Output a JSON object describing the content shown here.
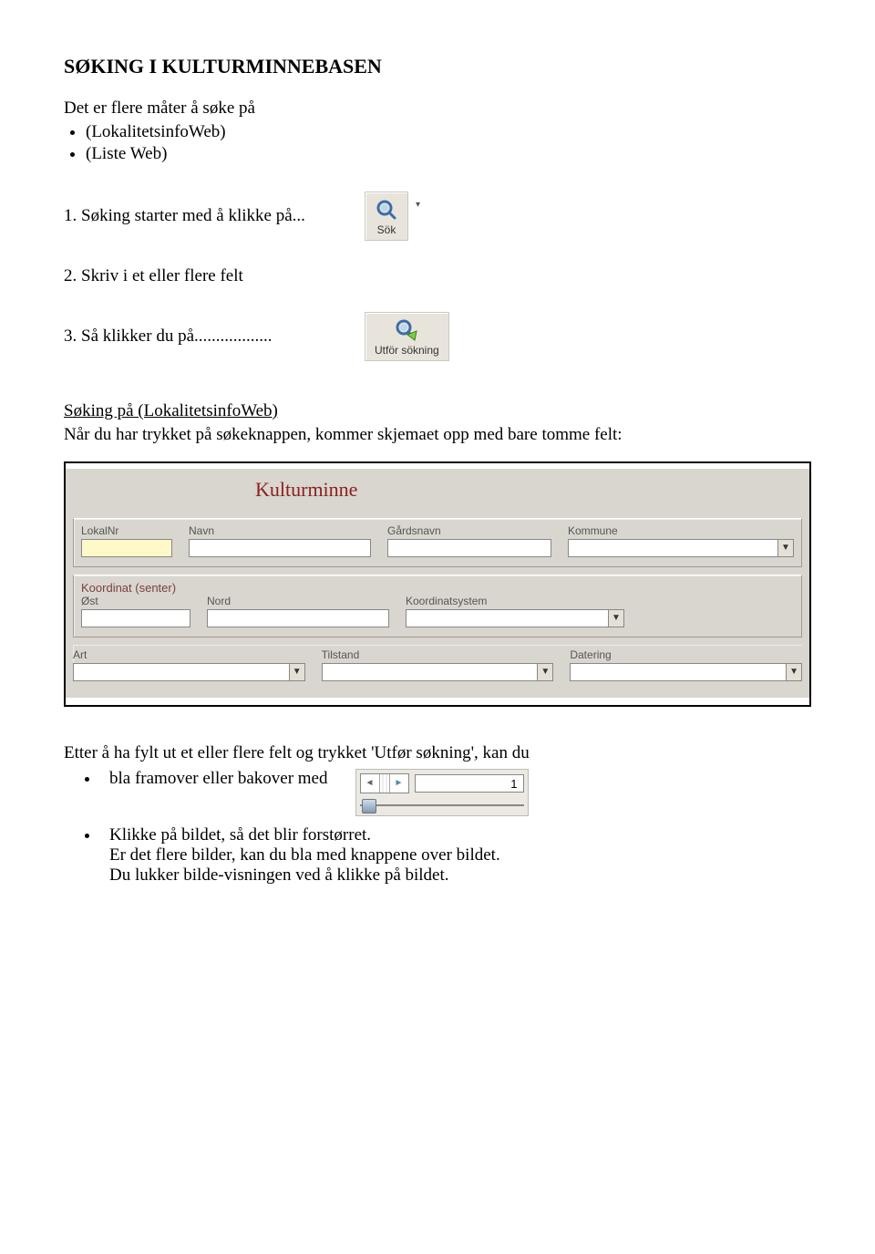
{
  "title": "SØKING I KULTURMINNEBASEN",
  "intro": "Det er flere måter å søke på",
  "methods": [
    "(LokalitetsinfoWeb)",
    "(Liste Web)"
  ],
  "steps": {
    "s1": "1.  Søking starter med å klikke på...",
    "s2": "2.  Skriv i et eller flere felt",
    "s3": "3.  Så klikker du på.................."
  },
  "buttons": {
    "sok_label": "Sök",
    "utfor_label": "Utför sökning"
  },
  "section": {
    "heading": "Søking på (LokalitetsinfoWeb)",
    "sub": "Når du har trykket på søkeknappen, kommer skjemaet opp med bare tomme felt:"
  },
  "form": {
    "title": "Kulturminne",
    "row1": {
      "lokalnr": "LokalNr",
      "navn": "Navn",
      "gardsnavn": "Gårdsnavn",
      "kommune": "Kommune"
    },
    "group2": {
      "legend": "Koordinat (senter)",
      "ost": "Øst",
      "nord": "Nord",
      "koordsys": "Koordinatsystem"
    },
    "row3": {
      "art": "Art",
      "tilstand": "Tilstand",
      "datering": "Datering"
    }
  },
  "after": "Etter å ha fylt ut et eller flere felt og trykket 'Utfør søkning', kan du",
  "bullets2": {
    "b1": "bla framover eller bakover med",
    "b2a": "Klikke på bildet, så det blir forstørret.",
    "b2b": "Er det flere bilder, kan du bla med knappene over bildet.",
    "b2c": "Du lukker bilde-visningen ved å klikke på bildet."
  },
  "nav": {
    "page": "1"
  }
}
